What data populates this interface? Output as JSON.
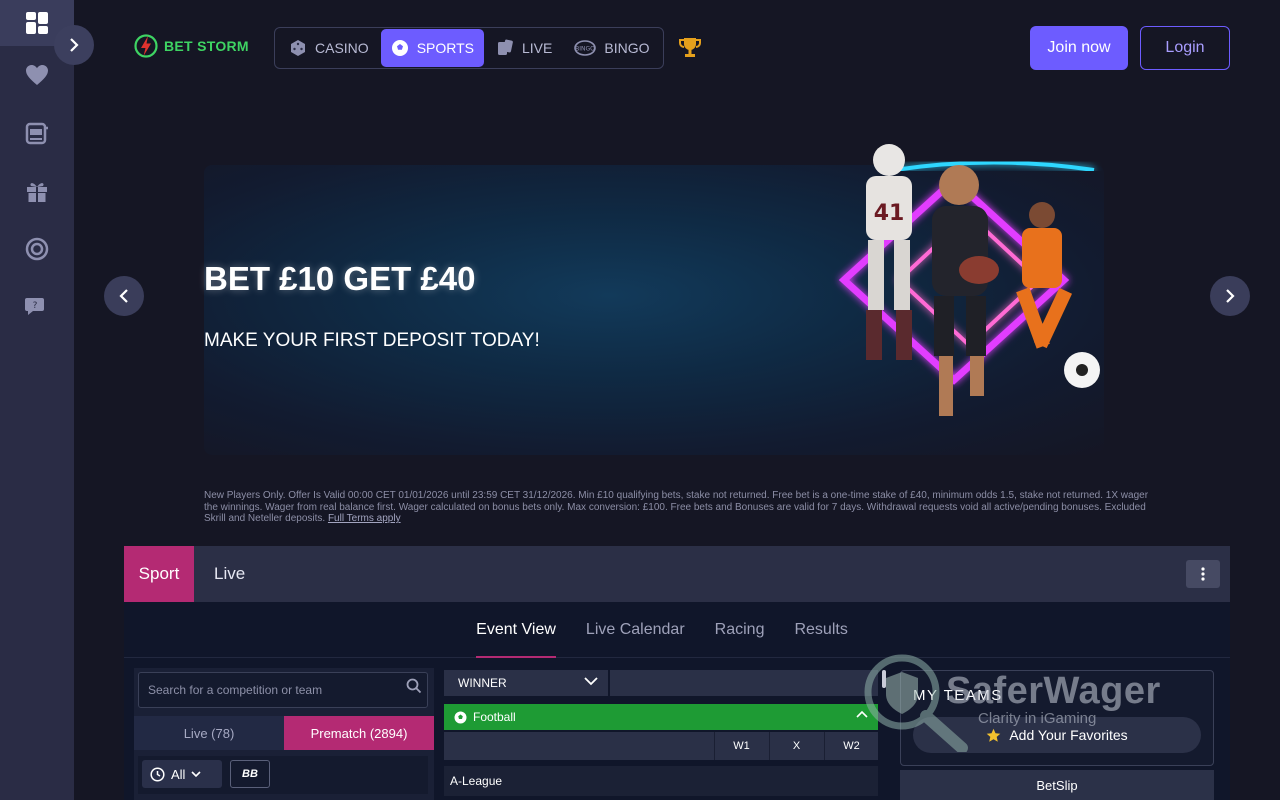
{
  "brand": {
    "name": "BET STORM"
  },
  "nav": {
    "items": [
      {
        "label": "CASINO",
        "icon": "dice-icon"
      },
      {
        "label": "SPORTS",
        "icon": "soccer-ball-icon"
      },
      {
        "label": "LIVE",
        "icon": "cards-icon"
      },
      {
        "label": "BINGO",
        "icon": "bingo-ball-icon"
      }
    ],
    "active": "SPORTS"
  },
  "header": {
    "join_label": "Join now",
    "login_label": "Login"
  },
  "banner": {
    "title": "BET £10 GET £40",
    "subtitle": "MAKE YOUR FIRST DEPOSIT TODAY!",
    "terms": "New Players Only. Offer Is Valid 00:00 CET 01/01/2026 until 23:59 CET 31/12/2026. Min £10 qualifying bets, stake not returned. Free bet is a one-time stake of £40, minimum odds 1.5, stake not returned. 1X wager the winnings. Wager from real balance first. Wager calculated on bonus bets only. Max conversion: £100. Free bets and Bonuses are valid for 7 days. Withdrawal requests void all active/pending bonuses. Excluded Skrill and Neteller deposits.",
    "terms_link": "Full Terms apply"
  },
  "sportsbook": {
    "top_tabs": {
      "sport": "Sport",
      "live": "Live"
    },
    "event_tabs": [
      "Event View",
      "Live Calendar",
      "Racing",
      "Results"
    ],
    "search_placeholder": "Search for a competition or team",
    "live_count_label": "Live (78)",
    "prematch_label": "Prematch (2894)",
    "time_filter": "All",
    "bb_label": "BB",
    "market_select": "WINNER",
    "sport_name": "Football",
    "odds_cols": [
      "W1",
      "X",
      "W2"
    ],
    "league": "A-League",
    "my_teams_title": "MY TEAMS",
    "add_favorites": "Add Your Favorites",
    "betslip": "BetSlip"
  },
  "watermark": {
    "name": "SaferWager",
    "tagline": "Clarity in iGaming"
  },
  "colors": {
    "accent": "#6d5cff",
    "sport_tab": "#b42a73",
    "football": "#1e9b34",
    "logo": "#3ed463"
  }
}
